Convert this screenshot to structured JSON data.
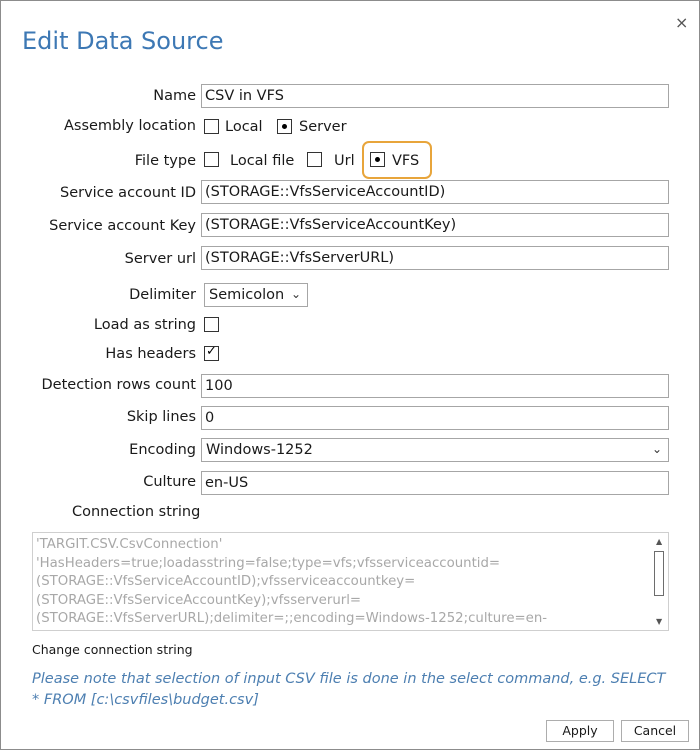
{
  "dialog": {
    "title": "Edit Data Source",
    "close_glyph": "×"
  },
  "form": {
    "name": {
      "label": "Name",
      "value": "CSV in VFS"
    },
    "assembly_location": {
      "label": "Assembly location",
      "options": [
        "Local",
        "Server"
      ],
      "selected": "Server"
    },
    "file_type": {
      "label": "File type",
      "options": [
        "Local file",
        "Url",
        "VFS"
      ],
      "selected": "VFS"
    },
    "service_account_id": {
      "label": "Service account ID",
      "value": "(STORAGE::VfsServiceAccountID)"
    },
    "service_account_key": {
      "label": "Service account Key",
      "value": "(STORAGE::VfsServiceAccountKey)"
    },
    "server_url": {
      "label": "Server url",
      "value": "(STORAGE::VfsServerURL)"
    },
    "delimiter": {
      "label": "Delimiter",
      "value": "Semicolon"
    },
    "load_as_string": {
      "label": "Load as string",
      "checked": false
    },
    "has_headers": {
      "label": "Has headers",
      "checked": true
    },
    "detection_rows_count": {
      "label": "Detection rows count",
      "value": "100"
    },
    "skip_lines": {
      "label": "Skip lines",
      "value": "0"
    },
    "encoding": {
      "label": "Encoding",
      "value": "Windows-1252"
    },
    "culture": {
      "label": "Culture",
      "value": "en-US"
    },
    "connection_string": {
      "label": "Connection string",
      "value": "'TARGIT.CSV.CsvConnection'\n'HasHeaders=true;loadasstring=false;type=vfs;vfsserviceaccountid=\n(STORAGE::VfsServiceAccountID);vfsserviceaccountkey=\n(STORAGE::VfsServiceAccountKey);vfsserverurl=\n(STORAGE::VfsServerURL);delimiter=;;encoding=Windows-1252;culture=en-"
    },
    "change_connection_string": "Change connection string"
  },
  "note": "Please note that selection of input CSV file is done in the select command, e.g. SELECT * FROM [c:\\csvfiles\\budget.csv]",
  "buttons": {
    "apply": "Apply",
    "cancel": "Cancel"
  },
  "colors": {
    "title": "#3d78b4",
    "highlight": "#e8a53b",
    "note": "#4d7fb1"
  },
  "icons": {
    "close": "close-icon",
    "dropdown": "chevron-down-icon",
    "check": "checkmark-icon"
  }
}
